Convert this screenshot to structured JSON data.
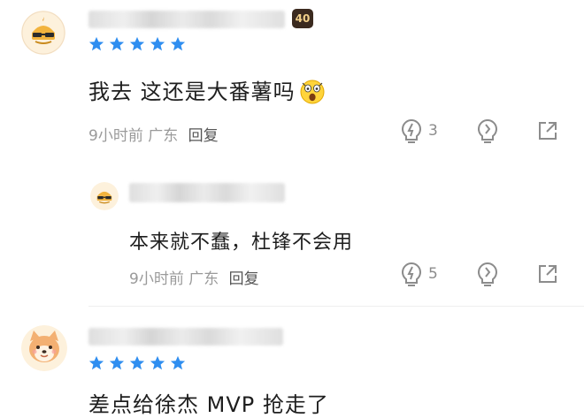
{
  "comments": [
    {
      "level": "40",
      "text": "我去 这还是大番薯吗",
      "emoji": "shocked-face-emoji",
      "time": "9小时前",
      "location": "广东",
      "reply_label": "回复",
      "like_count": "3"
    },
    {
      "text": "差点给徐杰 MVP 抢走了"
    }
  ],
  "reply": {
    "text": "本来就不蠢，杜锋不会用",
    "time": "9小时前",
    "location": "广东",
    "reply_label": "回复",
    "like_count": "5"
  },
  "colors": {
    "star_blue": "#2f8ef0",
    "icon_gray": "#8c8c8c",
    "avatar_bg": "#fdf1dc"
  }
}
